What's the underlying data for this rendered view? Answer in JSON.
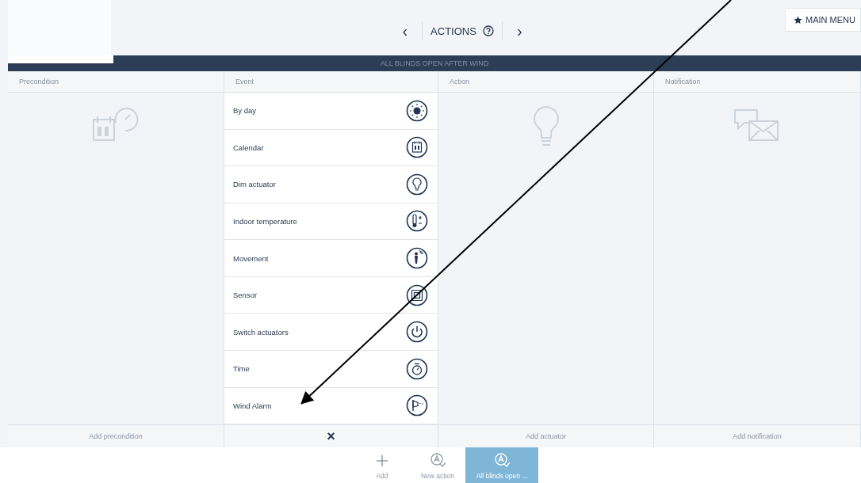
{
  "header": {
    "title": "ACTIONS",
    "prev": "‹",
    "next": "›",
    "main_menu": "MAIN MENU"
  },
  "action_bar": {
    "title": "ALL BLINDS OPEN AFTER WIND"
  },
  "columns": [
    {
      "label": "Precondition",
      "footer": "Add precondition"
    },
    {
      "label": "Event",
      "footer": "×"
    },
    {
      "label": "Action",
      "footer": "Add actuator"
    },
    {
      "label": "Notification",
      "footer": "Add notification"
    }
  ],
  "events": [
    {
      "label": "By day"
    },
    {
      "label": "Calendar"
    },
    {
      "label": "Dim actuator"
    },
    {
      "label": "Indoor temperature"
    },
    {
      "label": "Movement"
    },
    {
      "label": "Sensor"
    },
    {
      "label": "Switch actuators"
    },
    {
      "label": "Time"
    },
    {
      "label": "Wind Alarm"
    }
  ],
  "toolbar": [
    {
      "label": "Add",
      "selected": false
    },
    {
      "label": "New action",
      "selected": false
    },
    {
      "label": "All blinds open ...",
      "selected": true
    }
  ]
}
